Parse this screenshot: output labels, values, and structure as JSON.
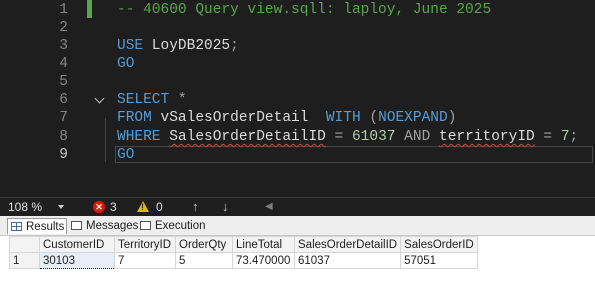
{
  "editor": {
    "lines": [
      {
        "num": "1",
        "tokens": [
          {
            "t": "-- 40600 Query view.sqll: laploy, June 2025",
            "c": "cmt"
          }
        ]
      },
      {
        "num": "2",
        "tokens": []
      },
      {
        "num": "3",
        "tokens": [
          {
            "t": "USE",
            "c": "kw"
          },
          {
            "t": " LoyDB2025",
            "c": "id"
          },
          {
            "t": ";",
            "c": "op"
          }
        ]
      },
      {
        "num": "4",
        "tokens": [
          {
            "t": "GO",
            "c": "kw"
          }
        ]
      },
      {
        "num": "5",
        "tokens": []
      },
      {
        "num": "6",
        "tokens": [
          {
            "t": "SELECT",
            "c": "kw"
          },
          {
            "t": " *",
            "c": "op"
          }
        ]
      },
      {
        "num": "7",
        "tokens": [
          {
            "t": "FROM",
            "c": "kw"
          },
          {
            "t": " vSalesOrderDetail  ",
            "c": "id"
          },
          {
            "t": "WITH",
            "c": "kw"
          },
          {
            "t": " (",
            "c": "op"
          },
          {
            "t": "NOEXPAND",
            "c": "kw"
          },
          {
            "t": ")",
            "c": "op"
          }
        ]
      },
      {
        "num": "8",
        "tokens": [
          {
            "t": "WHERE",
            "c": "kw"
          },
          {
            "t": " ",
            "c": "id"
          },
          {
            "t": "SalesOrderDetailID",
            "c": "id sq"
          },
          {
            "t": " = ",
            "c": "op"
          },
          {
            "t": "61037",
            "c": "num"
          },
          {
            "t": " AND ",
            "c": "op"
          },
          {
            "t": "territoryID",
            "c": "id sq"
          },
          {
            "t": " = ",
            "c": "op"
          },
          {
            "t": "7",
            "c": "num"
          },
          {
            "t": ";",
            "c": "op"
          }
        ]
      },
      {
        "num": "9",
        "tokens": [
          {
            "t": "GO",
            "c": "kw"
          }
        ]
      }
    ],
    "active_line": "9"
  },
  "status": {
    "zoom": "108 %",
    "errors": "3",
    "warnings": "0",
    "nav_up": "↑",
    "nav_down": "↓"
  },
  "tabs": {
    "results": "Results",
    "messages": "Messages",
    "execution_plan": "Execution plan"
  },
  "grid": {
    "columns": [
      "CustomerID",
      "TerritoryID",
      "OrderQty",
      "LineTotal",
      "SalesOrderDetailID",
      "SalesOrderID"
    ],
    "rows": [
      {
        "num": "1",
        "cells": [
          "30103",
          "7",
          "5",
          "73.470000",
          "61037",
          "57051"
        ]
      }
    ]
  },
  "colors": {
    "keyword": "#569cd6",
    "comment": "#57a64a",
    "number": "#b5cea8",
    "error_icon": "#e51400",
    "warning_icon": "#e2b719"
  },
  "icons": [
    "error-icon",
    "warning-icon",
    "arrow-up-icon",
    "arrow-down-icon",
    "grid-icon",
    "messages-icon",
    "execution-plan-icon",
    "fold-chevron-icon"
  ]
}
